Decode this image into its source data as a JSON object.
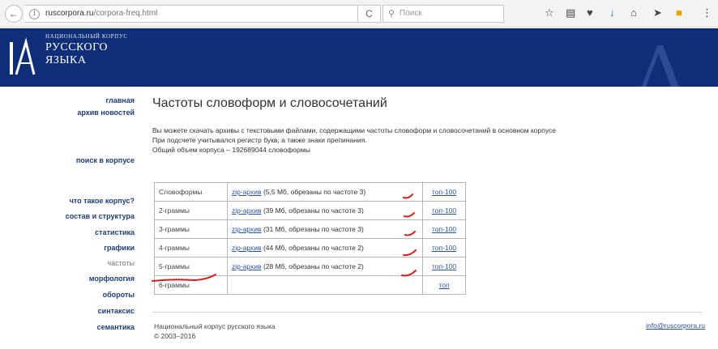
{
  "browser": {
    "back_glyph": "←",
    "info_glyph": "i",
    "url_host": "ruscorpora.ru",
    "url_path": "/corpora-freq.html",
    "reload_glyph": "C",
    "search_placeholder": "Поиск",
    "toolbar_icons": [
      "star-icon",
      "reading-list-icon",
      "pocket-icon",
      "download-icon",
      "home-icon",
      "send-icon",
      "extension-icon"
    ]
  },
  "site": {
    "name_line1": "НАЦИОНАЛЬНЫЙ КОРПУС",
    "name_line2": "РУССКОГО",
    "name_line3": "ЯЗЫКА",
    "brand_color": "#0f2e78"
  },
  "sidebar": {
    "items": [
      {
        "label": "главная"
      },
      {
        "label": "архив новостей"
      },
      {
        "label": "поиск в корпусе"
      },
      {
        "label": "что такое корпус?"
      },
      {
        "label": "состав и структура"
      },
      {
        "label": "статистика"
      },
      {
        "label": "графики"
      },
      {
        "label": "частоты",
        "current": true
      },
      {
        "label": "морфология"
      },
      {
        "label": "обороты"
      },
      {
        "label": "синтаксис"
      },
      {
        "label": "семантика"
      }
    ]
  },
  "main": {
    "title": "Частоты словоформ и словосочетаний",
    "intro_line1": "Вы можете скачать архивы с текстовыми файлами, содержащими частоты словоформ и словосочетаний в основном корпусе",
    "intro_line2": "При подсчете учитывался регистр букв, а также знаки препинания.",
    "intro_line3": "Общий объем корпуса – 192689044 словоформы",
    "table": [
      {
        "name": "Словоформы",
        "link": "zip-архив",
        "note": " (5,5 Мб, обрезаны по частоте 3)",
        "top": "топ-100"
      },
      {
        "name": "2-граммы",
        "link": "zip-архив",
        "note": " (39 Мб, обрезаны по частоте 3)",
        "top": "топ-100"
      },
      {
        "name": "3-граммы",
        "link": "zip-архив",
        "note": " (31 Мб, обрезаны по частоте 3)",
        "top": "топ-100"
      },
      {
        "name": "4-граммы",
        "link": "zip-архив",
        "note": " (44 Мб, обрезаны по частоте 2)",
        "top": "топ-100"
      },
      {
        "name": "5-граммы",
        "link": "zip-архив",
        "note": " (28 Мб, обрезаны по частоте 2)",
        "top": "топ-100"
      },
      {
        "name": "6-граммы",
        "link": "",
        "note": "",
        "top": "топ"
      }
    ]
  },
  "footer": {
    "line1": "Национальный корпус русского языка",
    "line2": "© 2003–2016",
    "email": "info@ruscorpora.ru"
  }
}
